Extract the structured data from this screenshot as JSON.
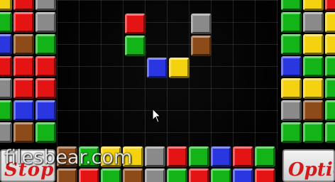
{
  "game": {
    "left_button_label": "Stop",
    "right_button_label": "Options",
    "watermark_text": "filesbear.com"
  },
  "colors": {
    "red": "#e41414",
    "green": "#12b418",
    "blue": "#2a37e0",
    "yellow": "#f5d20f",
    "gray": "#8a8a8a",
    "brown": "#8d4b1a"
  },
  "left_panel_rows": [
    [
      "yellow",
      "red",
      "gray"
    ],
    [
      "green",
      "red",
      "gray"
    ],
    [
      "blue",
      "brown",
      "green"
    ],
    [
      "red",
      "red",
      "red"
    ],
    [
      "gray",
      "red",
      "red"
    ],
    [
      "green",
      "blue",
      "blue"
    ],
    [
      "gray",
      "brown",
      "green"
    ]
  ],
  "right_panel_rows": [
    [
      "green",
      "yellow",
      "red"
    ],
    [
      "green",
      "gray",
      "yellow"
    ],
    [
      "green",
      "yellow",
      "yellow"
    ],
    [
      "blue",
      "green",
      "green"
    ],
    [
      "yellow",
      "yellow",
      "green"
    ],
    [
      "gray",
      "brown",
      "green"
    ],
    [
      "green",
      "green",
      "green"
    ]
  ],
  "bottom_row": [
    "brown",
    "green",
    "yellow",
    "yellow",
    "gray",
    "red",
    "green",
    "blue",
    "red",
    "green"
  ],
  "bottom_row2": [
    "brown",
    "red",
    "green",
    "brown",
    "gray",
    "green",
    "red",
    "green",
    "blue",
    "red"
  ],
  "falling_piece": [
    {
      "color": "red"
    },
    {
      "color": "green"
    }
  ],
  "falling_piece2": [
    {
      "color": "gray"
    },
    {
      "color": "brown"
    }
  ],
  "falling_piece3": [
    {
      "color": "blue"
    },
    {
      "color": "yellow"
    }
  ]
}
